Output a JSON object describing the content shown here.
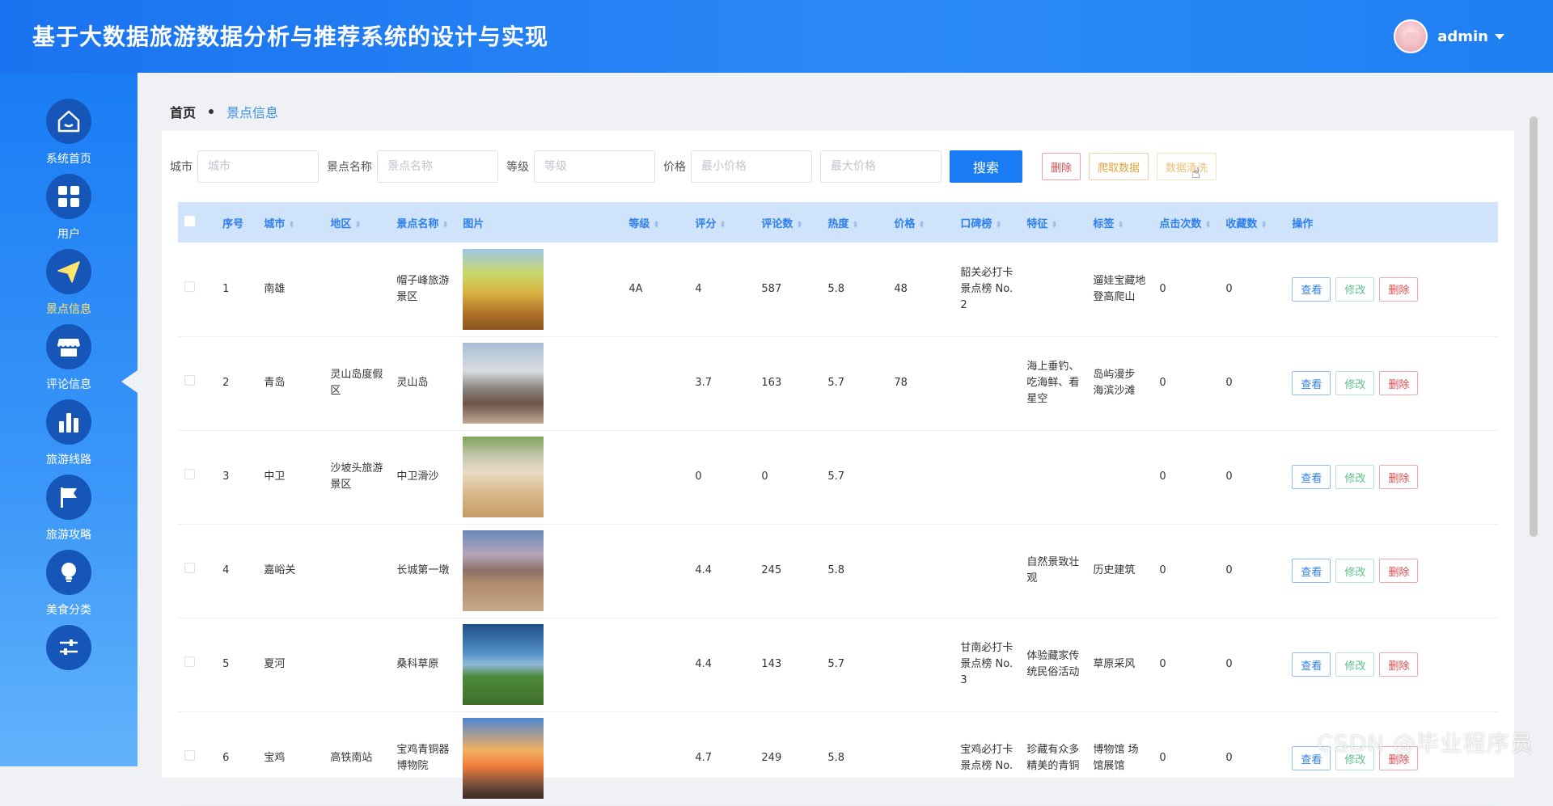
{
  "header": {
    "title": "基于大数据旅游数据分析与推荐系统的设计与实现",
    "username": "admin"
  },
  "sidebar": {
    "items": [
      {
        "label": "系统首页",
        "icon": "home-icon"
      },
      {
        "label": "用户",
        "icon": "grid-icon"
      },
      {
        "label": "景点信息",
        "icon": "paper-plane-icon",
        "active": true
      },
      {
        "label": "评论信息",
        "icon": "store-icon"
      },
      {
        "label": "旅游线路",
        "icon": "bar-chart-icon"
      },
      {
        "label": "旅游攻略",
        "icon": "flag-icon"
      },
      {
        "label": "美食分类",
        "icon": "bulb-icon"
      },
      {
        "label": "",
        "icon": "sliders-icon"
      }
    ]
  },
  "breadcrumb": {
    "home": "首页",
    "current": "景点信息"
  },
  "search": {
    "city_label": "城市",
    "city_placeholder": "城市",
    "name_label": "景点名称",
    "name_placeholder": "景点名称",
    "level_label": "等级",
    "level_placeholder": "等级",
    "price_label": "价格",
    "min_price_placeholder": "最小价格",
    "max_price_placeholder": "最大价格",
    "search_btn": "搜索",
    "delete_btn": "删除",
    "crawl_btn": "爬取数据",
    "clean_btn": "数据清洗"
  },
  "table": {
    "headers": {
      "index": "序号",
      "city": "城市",
      "area": "地区",
      "name": "景点名称",
      "image": "图片",
      "level": "等级",
      "score": "评分",
      "comments": "评论数",
      "heat": "热度",
      "price": "价格",
      "rank": "口碑榜",
      "feature": "特征",
      "tags": "标签",
      "clicks": "点击次数",
      "favorites": "收藏数",
      "ops": "操作"
    },
    "actions": {
      "view": "查看",
      "edit": "修改",
      "delete": "删除"
    },
    "rows": [
      {
        "index": "1",
        "city": "南雄",
        "area": "",
        "name": "帽子峰旅游景区",
        "level": "4A",
        "score": "4",
        "comments": "587",
        "heat": "5.8",
        "price": "48",
        "rank": "韶关必打卡景点榜 No. 2",
        "feature": "",
        "tags": "遛娃宝藏地 登高爬山",
        "clicks": "0",
        "favorites": "0"
      },
      {
        "index": "2",
        "city": "青岛",
        "area": "灵山岛度假区",
        "name": "灵山岛",
        "level": "",
        "score": "3.7",
        "comments": "163",
        "heat": "5.7",
        "price": "78",
        "rank": "",
        "feature": "海上垂钓、吃海鲜、看星空",
        "tags": "岛屿漫步 海滨沙滩",
        "clicks": "0",
        "favorites": "0"
      },
      {
        "index": "3",
        "city": "中卫",
        "area": "沙坡头旅游景区",
        "name": "中卫滑沙",
        "level": "",
        "score": "0",
        "comments": "0",
        "heat": "5.7",
        "price": "",
        "rank": "",
        "feature": "",
        "tags": "",
        "clicks": "0",
        "favorites": "0"
      },
      {
        "index": "4",
        "city": "嘉峪关",
        "area": "",
        "name": "长城第一墩",
        "level": "",
        "score": "4.4",
        "comments": "245",
        "heat": "5.8",
        "price": "",
        "rank": "",
        "feature": "自然景致壮观",
        "tags": "历史建筑",
        "clicks": "0",
        "favorites": "0"
      },
      {
        "index": "5",
        "city": "夏河",
        "area": "",
        "name": "桑科草原",
        "level": "",
        "score": "4.4",
        "comments": "143",
        "heat": "5.7",
        "price": "",
        "rank": "甘南必打卡景点榜 No. 3",
        "feature": "体验藏家传统民俗活动",
        "tags": "草原采风",
        "clicks": "0",
        "favorites": "0"
      },
      {
        "index": "6",
        "city": "宝鸡",
        "area": "高铁南站",
        "name": "宝鸡青铜器博物院",
        "level": "",
        "score": "4.7",
        "comments": "249",
        "heat": "5.8",
        "price": "",
        "rank": "宝鸡必打卡景点榜 No.",
        "feature": "珍藏有众多精美的青铜",
        "tags": "博物馆 场馆展馆",
        "clicks": "0",
        "favorites": "0"
      }
    ]
  },
  "watermark": "CSDN @毕业程序员"
}
